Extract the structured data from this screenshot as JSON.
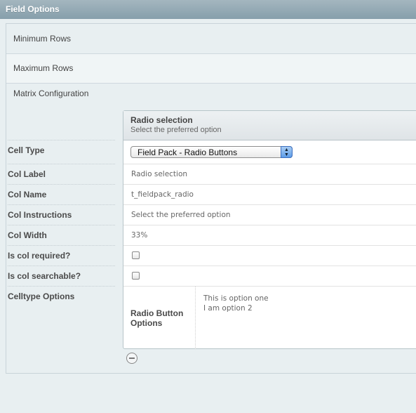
{
  "header": {
    "title": "Field Options"
  },
  "settings": {
    "minimum_rows": "Minimum Rows",
    "maximum_rows": "Maximum Rows",
    "matrix_configuration": "Matrix Configuration"
  },
  "column_settings": {
    "labels": [
      "Cell Type",
      "Col Label",
      "Col Name",
      "Col Instructions",
      "Col Width",
      "Is col required?",
      "Is col searchable?",
      "Celltype Options"
    ]
  },
  "column": {
    "title": "Radio selection",
    "subtitle": "Select the preferred option",
    "cell_type": "Field Pack - Radio Buttons",
    "col_label": "Radio selection",
    "col_name": "t_fieldpack_radio",
    "col_instructions": "Select the preferred option",
    "col_width": "33%",
    "is_required": false,
    "is_searchable": false,
    "celltype_options": {
      "label": "Radio Button Options",
      "options": [
        "This is option one",
        "I am option 2"
      ],
      "options_text": "This is option one\nI am option 2"
    }
  },
  "icons": {
    "select_arrows": "up-down-arrows",
    "remove_column": "minus-circle"
  }
}
